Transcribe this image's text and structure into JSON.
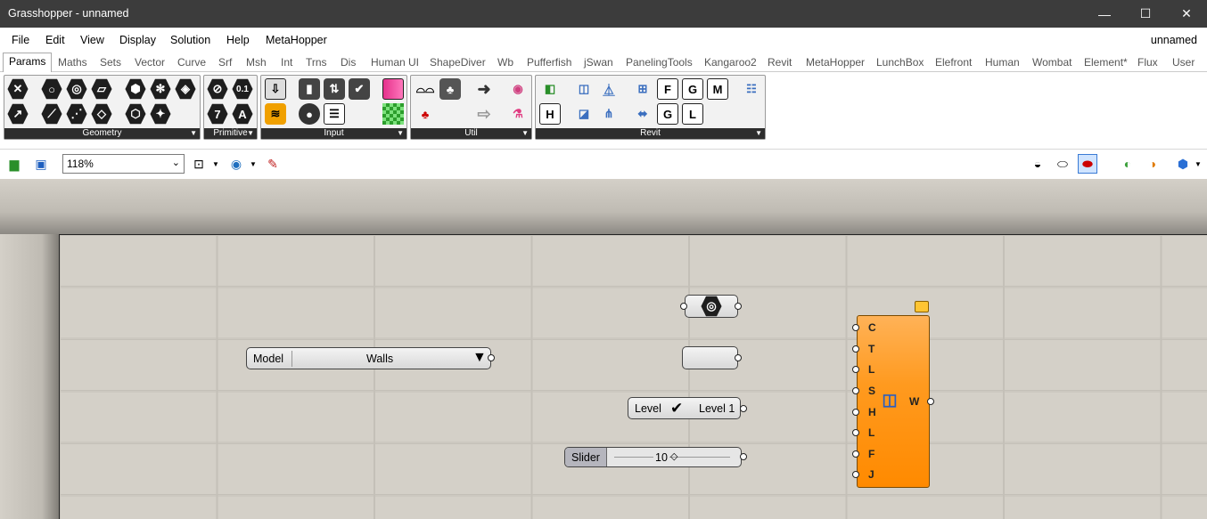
{
  "window": {
    "title": "Grasshopper - unnamed",
    "minimize": "—",
    "maximize": "☐",
    "close": "✕"
  },
  "menu": {
    "items": [
      "File",
      "Edit",
      "View",
      "Display",
      "Solution",
      "Help",
      "MetaHopper"
    ],
    "document": "unnamed"
  },
  "tabs": [
    "Params",
    "Maths",
    "Sets",
    "Vector",
    "Curve",
    "Srf",
    "Msh",
    "Int",
    "Trns",
    "Dis",
    "Human UI",
    "ShapeDiver",
    "Wb",
    "Pufferfish",
    "jSwan",
    "PanelingTools",
    "Kangaroo2",
    "Revit",
    "MetaHopper",
    "LunchBox",
    "Elefront",
    "Human",
    "Wombat",
    "Element*",
    "Flux",
    "User"
  ],
  "active_tab": "Params",
  "ribbon": {
    "panels": [
      "Geometry",
      "Primitive",
      "Input",
      "Util",
      "Revit"
    ],
    "primitive_icons": [
      "0.1",
      "7",
      "A"
    ],
    "revit_icons": [
      "F",
      "G",
      "M",
      "H",
      "G",
      "L"
    ]
  },
  "toolbar": {
    "zoom": "118%"
  },
  "canvas": {
    "model_picker": {
      "label": "Model",
      "value": "Walls"
    },
    "level_picker": {
      "label": "Level",
      "value": "Level 1"
    },
    "slider": {
      "label": "Slider",
      "value": "10"
    },
    "component": {
      "inputs": [
        "C",
        "T",
        "L",
        "S",
        "H",
        "L",
        "F",
        "J"
      ],
      "output": "W"
    }
  },
  "colors": {
    "titlebar": "#3c3c3c",
    "canvas": "#d4d0c8",
    "component": "#ff9a1f",
    "panel_label": "#2d2d2d"
  }
}
